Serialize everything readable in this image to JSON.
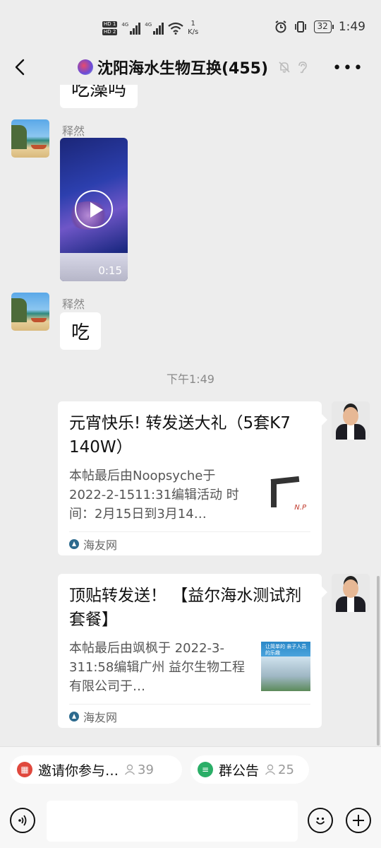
{
  "status_bar": {
    "hd1": "HD 1",
    "hd2": "HD 2",
    "net1": "4G",
    "net2": "4G",
    "speed_value": "1",
    "speed_unit": "K/s",
    "battery": "32",
    "time": "1:49"
  },
  "header": {
    "title": "沈阳海水生物互换(455)"
  },
  "messages": {
    "partial_text": "吃藻吗",
    "sender1": "释然",
    "video_duration": "0:15",
    "sender2": "释然",
    "text2": "吃",
    "timestamp": "下午1:49",
    "card1": {
      "title": "元宵快乐! 转发送大礼（5套K7 140W）",
      "desc": "本帖最后由Noopsyche于 2022-2-1511:31编辑活动 时间：2月15日到3月14…",
      "source": "海友网",
      "thumb_text": "N.P"
    },
    "card2": {
      "title": "顶贴转发送！ 【益尔海水测试剂套餐】",
      "desc": "本帖最后由飒枫于 2022-3-311:58编辑广州 益尔生物工程有限公司于…",
      "source": "海友网",
      "thumb_text": "让简单的 亲子人员的乐趣"
    }
  },
  "bottom": {
    "chip1_label": "邀请你参与…",
    "chip1_count": "39",
    "chip2_label": "群公告",
    "chip2_count": "25",
    "input_value": ""
  },
  "colors": {
    "background": "#ededed",
    "bubble": "#ffffff",
    "chip1_icon": "#e0483d",
    "chip2_icon": "#2aae67"
  }
}
